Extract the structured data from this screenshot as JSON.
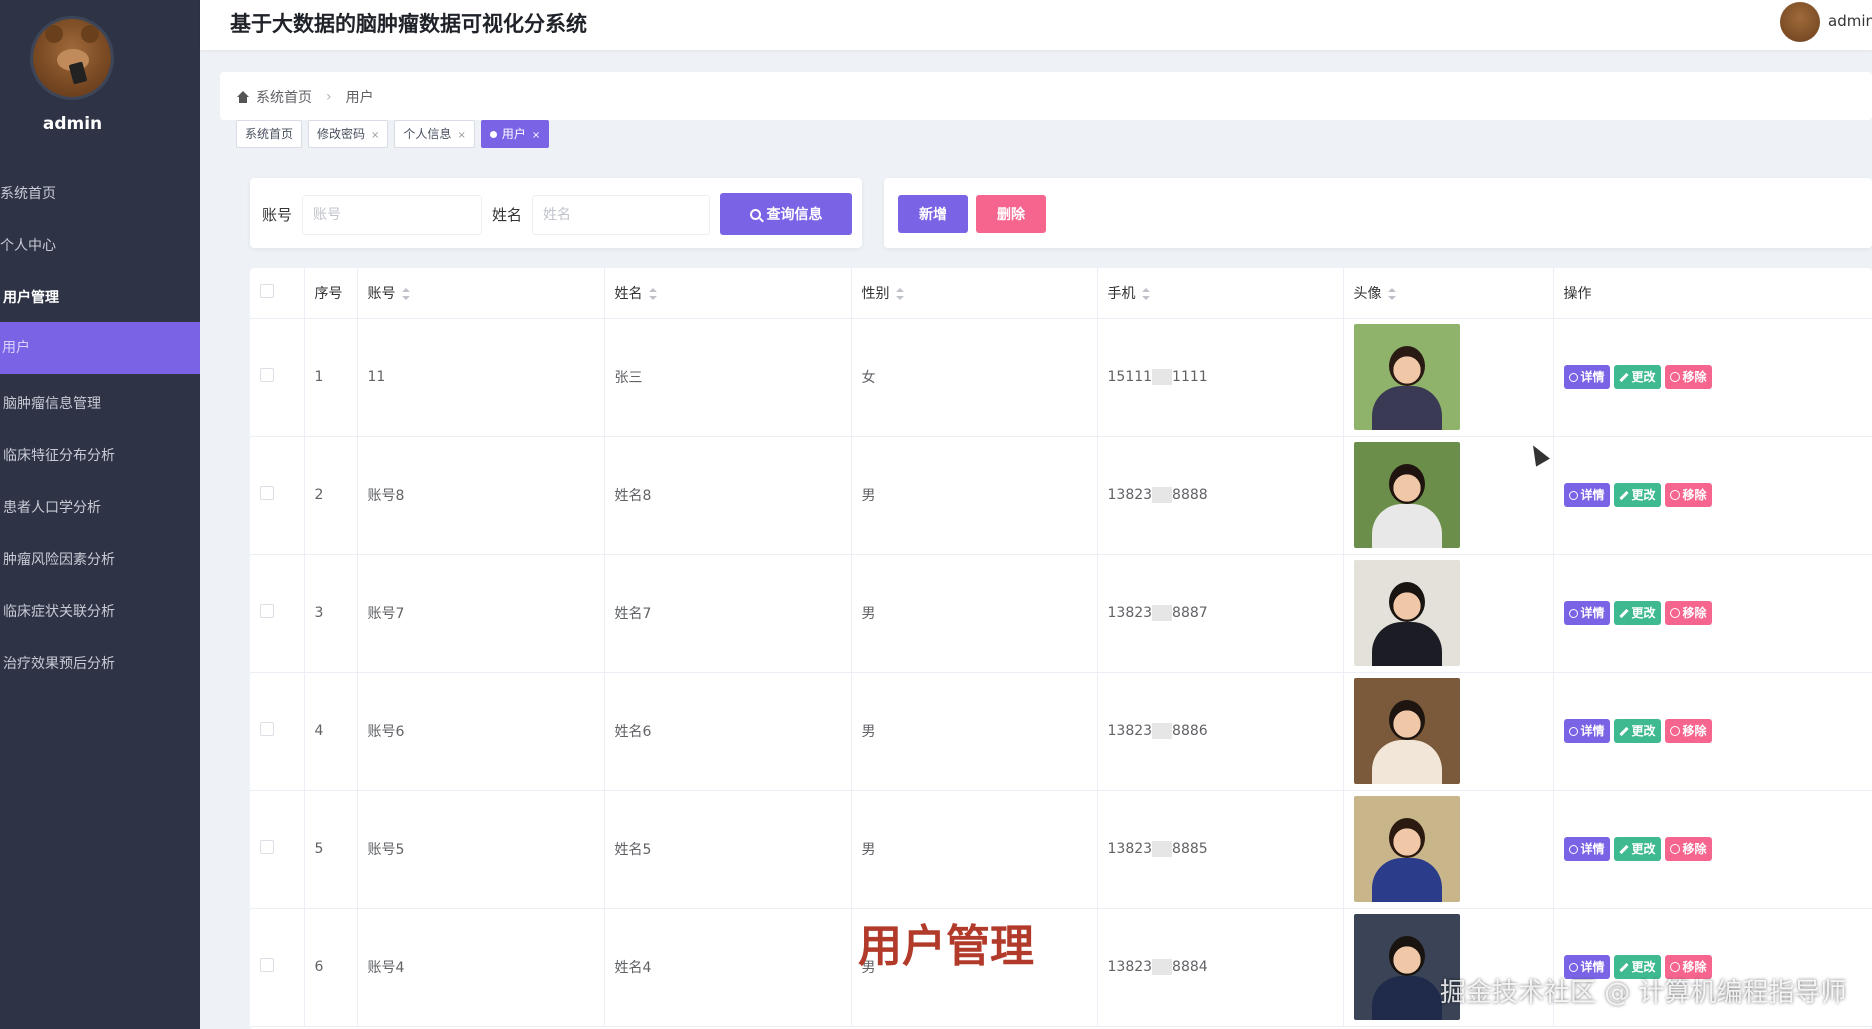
{
  "app": {
    "title": "基于大数据的脑肿瘤数据可视化分系统",
    "user": "admin"
  },
  "sidebar": {
    "username": "admin",
    "items": [
      {
        "label": "系统首页"
      },
      {
        "label": "个人中心"
      },
      {
        "label": "用户管理"
      },
      {
        "label": "用户"
      },
      {
        "label": "脑肿瘤信息管理"
      },
      {
        "label": "临床特征分布分析"
      },
      {
        "label": "患者人口学分析"
      },
      {
        "label": "肿瘤风险因素分析"
      },
      {
        "label": "临床症状关联分析"
      },
      {
        "label": "治疗效果预后分析"
      }
    ]
  },
  "breadcrumb": {
    "home": "系统首页",
    "current": "用户"
  },
  "tags": [
    {
      "label": "系统首页",
      "close": ""
    },
    {
      "label": "修改密码",
      "close": "×"
    },
    {
      "label": "个人信息",
      "close": "×"
    },
    {
      "label": "用户",
      "close": "×"
    }
  ],
  "search": {
    "account_label": "账号",
    "account_placeholder": "账号",
    "name_label": "姓名",
    "name_placeholder": "姓名",
    "query_button": "查询信息"
  },
  "actions": {
    "add": "新增",
    "delete": "删除"
  },
  "table": {
    "headers": {
      "index": "序号",
      "account": "账号",
      "name": "姓名",
      "gender": "性别",
      "phone": "手机",
      "avatar": "头像",
      "ops": "操作"
    },
    "rows": [
      {
        "index": "1",
        "account": "11",
        "name": "张三",
        "gender": "女",
        "phone_a": "15111",
        "phone_b": "1111"
      },
      {
        "index": "2",
        "account": "账号8",
        "name": "姓名8",
        "gender": "男",
        "phone_a": "13823",
        "phone_b": "8888"
      },
      {
        "index": "3",
        "account": "账号7",
        "name": "姓名7",
        "gender": "男",
        "phone_a": "13823",
        "phone_b": "8887"
      },
      {
        "index": "4",
        "account": "账号6",
        "name": "姓名6",
        "gender": "男",
        "phone_a": "13823",
        "phone_b": "8886"
      },
      {
        "index": "5",
        "account": "账号5",
        "name": "姓名5",
        "gender": "男",
        "phone_a": "13823",
        "phone_b": "8885"
      },
      {
        "index": "6",
        "account": "账号4",
        "name": "姓名4",
        "gender": "男",
        "phone_a": "13823",
        "phone_b": "8884"
      }
    ],
    "ops": {
      "detail": "详情",
      "edit": "更改",
      "remove": "移除"
    }
  },
  "overlay": {
    "title": "用户管理",
    "watermark": "掘金技术社区 @ 计算机编程指导师"
  },
  "colors": {
    "accent": "#7b63e6",
    "sidebar": "#2e3445",
    "edit": "#3fb98f",
    "danger": "#f5658d"
  }
}
